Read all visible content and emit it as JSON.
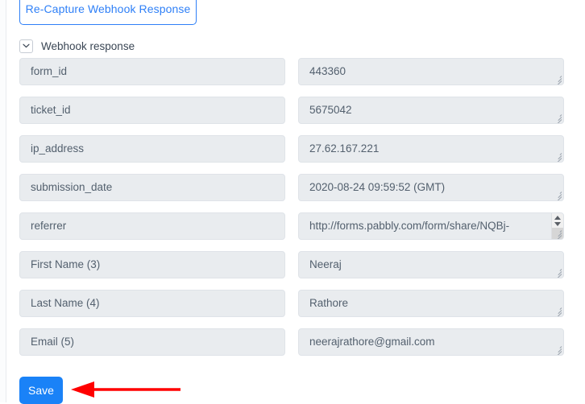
{
  "window": {
    "background": "#ffffff"
  },
  "toolbar": {
    "recapture_label": "Re-Capture Webhook Response"
  },
  "section": {
    "title": "Webhook response",
    "toggle_icon": "chevron-down-icon",
    "expanded": true
  },
  "fields": [
    {
      "key": "form_id",
      "value": "443360"
    },
    {
      "key": "ticket_id",
      "value": "5675042"
    },
    {
      "key": "ip_address",
      "value": "27.62.167.221"
    },
    {
      "key": "submission_date",
      "value": "2020-08-24 09:59:52 (GMT)"
    },
    {
      "key": "referrer",
      "value": "http://forms.pabbly.com/form/share/NQBj-",
      "scrollable": true
    },
    {
      "key": "First Name (3)",
      "value": "Neeraj"
    },
    {
      "key": "Last Name (4)",
      "value": "Rathore"
    },
    {
      "key": "Email (5)",
      "value": "neerajrathore@gmail.com"
    }
  ],
  "footer": {
    "save_label": "Save"
  },
  "annotation": {
    "type": "arrow-left",
    "color": "#ff0000"
  },
  "colors": {
    "accent_blue": "#1a82f7",
    "link_blue": "#2f80f7",
    "field_bg": "#e9ecef",
    "field_border": "#dfe3e8",
    "field_text": "#53606e",
    "annotation_red": "#ff0000"
  }
}
